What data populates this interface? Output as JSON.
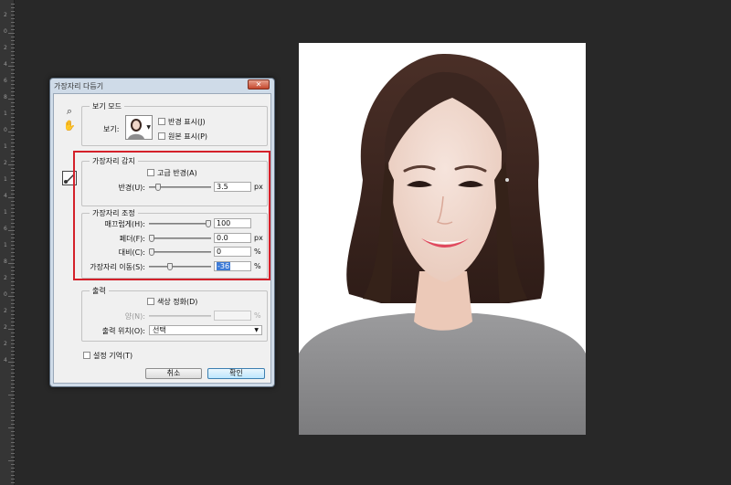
{
  "ruler": {
    "labels": [
      "2",
      "0",
      "2",
      "4",
      "6",
      "8",
      "1",
      "0",
      "1",
      "2",
      "1",
      "4",
      "1",
      "6",
      "1",
      "8",
      "2",
      "0",
      "2",
      "2",
      "2",
      "4"
    ]
  },
  "dialog": {
    "title": "가장자리 다듬기",
    "close_label": "✕",
    "view_mode": {
      "legend": "보기 모드",
      "view_label": "보기:",
      "show_radius_label": "반경 표시(J)",
      "show_original_label": "원본 표시(P)"
    },
    "edge_detection": {
      "legend": "가장자리 감지",
      "smart_radius_label": "고급 반경(A)",
      "radius_label": "반경(U):",
      "radius_value": "3.5",
      "radius_unit": "px",
      "radius_slider": 0.12
    },
    "adjust_edge": {
      "legend": "가장자리 조정",
      "smooth_label": "매끄럽게(H):",
      "smooth_value": "100",
      "smooth_slider": 1.0,
      "feather_label": "페더(F):",
      "feather_value": "0.0",
      "feather_unit": "px",
      "feather_slider": 0.0,
      "contrast_label": "대비(C):",
      "contrast_value": "0",
      "contrast_unit": "%",
      "contrast_slider": 0.0,
      "shift_edge_label": "가장자리 이동(S):",
      "shift_edge_value": "-36",
      "shift_edge_unit": "%",
      "shift_edge_slider": 0.32
    },
    "output": {
      "legend": "출력",
      "decontaminate_label": "색상 정화(D)",
      "amount_label": "양(N):",
      "amount_unit": "%",
      "output_to_label": "출력 위치(O):",
      "output_to_value": "선택"
    },
    "remember_settings_label": "설정 기억(T)",
    "cancel_label": "취소",
    "ok_label": "확인"
  },
  "icons": {
    "zoom": "magnifier-icon",
    "hand": "hand-icon",
    "brush": "refine-radius-brush-icon"
  },
  "colors": {
    "highlight": "#d4202a",
    "selection": "#3e7bd6",
    "lips": "#e0475d",
    "hair": "#3a2620",
    "sweater": "#8d8d8f"
  }
}
